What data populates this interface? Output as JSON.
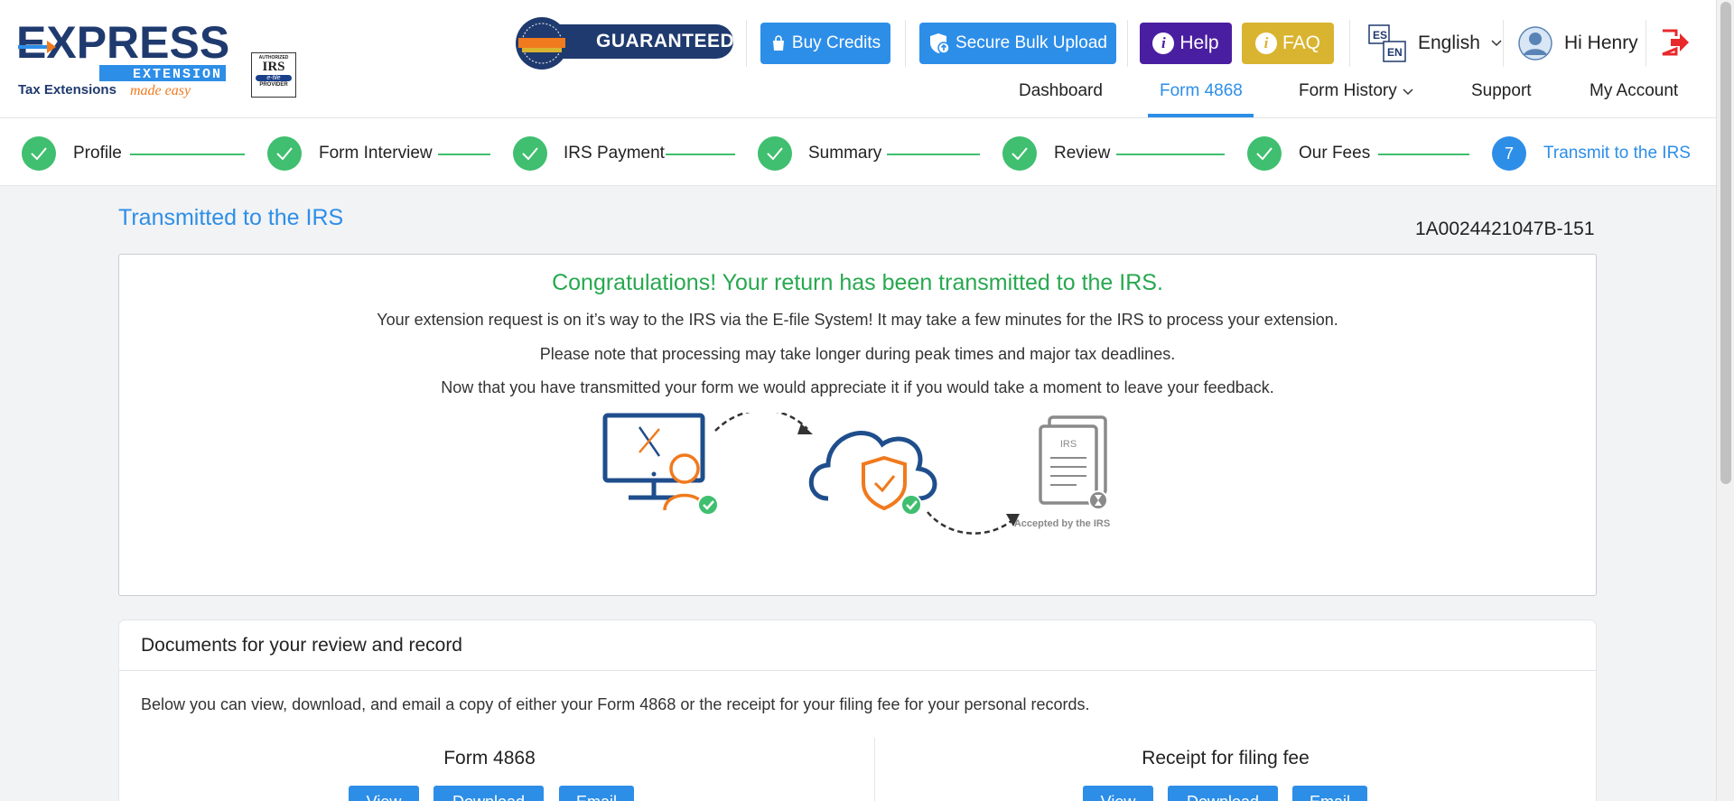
{
  "logo": {
    "brand": "EXPRESS",
    "sub": "EXTENSION",
    "tagline": "Tax Extensions",
    "tagline_script": "made easy"
  },
  "irs_badge": {
    "line1": "AUTHORIZED",
    "line2": "IRS",
    "line3": "e-file",
    "line4": "PROVIDER"
  },
  "header": {
    "guaranteed_label": "GUARANTEED",
    "buy_credits_label": "Buy Credits",
    "secure_bulk_upload_label": "Secure Bulk Upload",
    "help_label": "Help",
    "faq_label": "FAQ",
    "language_label": "English",
    "greeting": "Hi Henry"
  },
  "nav": {
    "items": [
      {
        "label": "Dashboard"
      },
      {
        "label": "Form 4868"
      },
      {
        "label": "Form History"
      },
      {
        "label": "Support"
      },
      {
        "label": "My Account"
      }
    ]
  },
  "stepper": {
    "steps": [
      {
        "label": "Profile",
        "status": "complete"
      },
      {
        "label": "Form Interview",
        "status": "complete"
      },
      {
        "label": "IRS Payment",
        "status": "complete"
      },
      {
        "label": "Summary",
        "status": "complete"
      },
      {
        "label": "Review",
        "status": "complete"
      },
      {
        "label": "Our Fees",
        "status": "complete"
      },
      {
        "label": "Transmit to the IRS",
        "status": "current",
        "number": "7"
      }
    ]
  },
  "main": {
    "title": "Transmitted to the IRS",
    "reference_id": "1A0024421047B-151",
    "congrats": "Congratulations! Your return has been transmitted to the IRS.",
    "message1": "Your extension request is on it’s way to the IRS via the E-file System! It may take a few minutes for the IRS to process your extension.",
    "message2": "Please note that processing may take longer during peak times and major tax deadlines.",
    "message3": "Now that you have transmitted your form we would appreciate it if you would take a moment to leave your feedback.",
    "illustration_caption": "Accepted by the IRS",
    "illustration_doc_label": "IRS"
  },
  "documents": {
    "heading": "Documents for your review and record",
    "description": "Below you can view, download, and email a copy of either your Form 4868 or the receipt for your filing fee for your personal records.",
    "columns": [
      {
        "title": "Form 4868",
        "view": "View",
        "download": "Download",
        "email": "Email"
      },
      {
        "title": "Receipt for filing fee",
        "view": "View",
        "download": "Download",
        "email": "Email"
      }
    ]
  },
  "colors": {
    "primary": "#2d8ee8",
    "success": "#27a84f",
    "help": "#4a1ea0",
    "faq": "#d9b430",
    "navy": "#1f3a6e",
    "orange": "#f07a1e"
  }
}
